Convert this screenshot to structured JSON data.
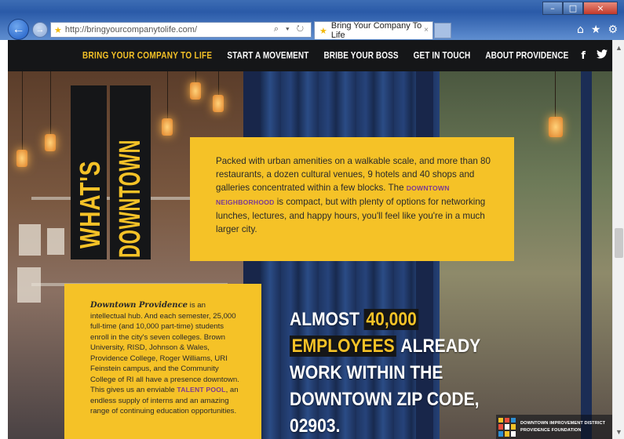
{
  "browser": {
    "url": "http://bringyourcompanytolife.com/",
    "address_tools": "⌕ ▾ ↻",
    "tab_title": "Bring Your Company To Life",
    "tab_close": "×",
    "back_icon": "←",
    "forward_icon": "→",
    "win_min": "–",
    "win_max": "□",
    "win_close": "×",
    "home_icon": "⌂",
    "favorites_icon": "★",
    "settings_icon": "⚙"
  },
  "nav": {
    "brand": "BRING YOUR COMPANY TO LIFE",
    "items": [
      "START A MOVEMENT",
      "BRIBE YOUR BOSS",
      "GET IN TOUCH",
      "ABOUT PROVIDENCE"
    ],
    "facebook": "f",
    "twitter": "❦"
  },
  "hero_title": {
    "line1": "WHAT'S",
    "line2": "DOWNTOWN"
  },
  "callout1": {
    "text_before": "Packed with urban amenities on a walkable scale, and more than 80 restaurants, a dozen cultural venues, 9 hotels and 40 shops and galleries concentrated within a few blocks. The ",
    "link": "DOWNTOWN NEIGHBORHOOD",
    "text_after": " is compact, but with plenty of options for networking lunches, lectures, and happy hours, you'll feel like you're in a much larger city."
  },
  "callout2": {
    "script_title": "Downtown Providence",
    "text_before": " is an intellectual hub. And each semester, 25,000 full-time (and 10,000 part-time) students enroll in the city's seven colleges. Brown University, RISD, Johnson & Wales, Providence College, Roger Williams, URI Feinstein campus, and the Community College of RI all have a presence downtown. This gives us an enviable ",
    "link": "TALENT POOL",
    "text_after": ", an endless supply of interns and an amazing range of continuing education opportunities."
  },
  "stat": {
    "w1": "ALMOST",
    "w2": "40,000",
    "w3": "EMPLOYEES",
    "w4": "ALREADY",
    "l3": "WORK WITHIN THE",
    "l4": "DOWNTOWN ZIP CODE,",
    "l5": "02903."
  },
  "sponsor": {
    "line1": "DOWNTOWN IMPROVEMENT DISTRICT",
    "line2": "PROVIDENCE FOUNDATION"
  },
  "colors": {
    "accent_yellow": "#f5c227",
    "link_purple": "#7b3a93",
    "nav_black": "#151618"
  }
}
